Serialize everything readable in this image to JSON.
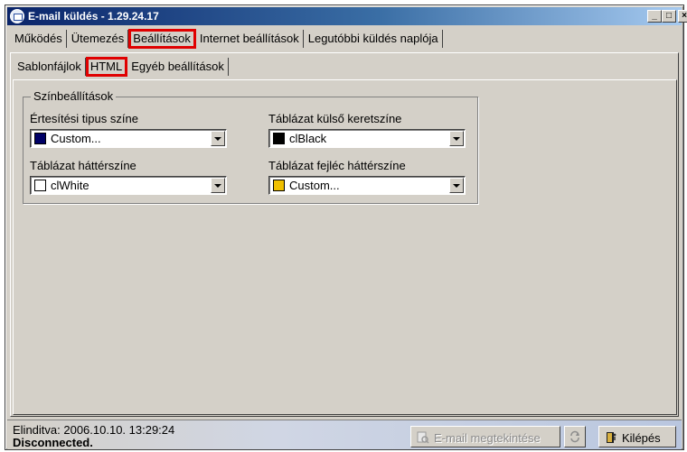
{
  "window": {
    "title": "E-mail küldés  - 1.29.24.17",
    "controls": {
      "minimize": "_",
      "maximize": "□",
      "close": "×"
    }
  },
  "main_tabs": [
    {
      "label": "Működés",
      "active": false
    },
    {
      "label": "Ütemezés",
      "active": false
    },
    {
      "label": "Beállítások",
      "active": true
    },
    {
      "label": "Internet beállítások",
      "active": false
    },
    {
      "label": "Legutóbbi küldés naplója",
      "active": false
    }
  ],
  "sub_tabs": [
    {
      "label": "Sablonfájlok",
      "active": false
    },
    {
      "label": "HTML",
      "active": true
    },
    {
      "label": "Egyéb beállítások",
      "active": false
    }
  ],
  "group": {
    "title": "Színbeállítások",
    "fields": [
      {
        "label": "Értesítési tipus színe",
        "value": "Custom...",
        "swatch": "#000066"
      },
      {
        "label": "Táblázat külső keretszíne",
        "value": "clBlack",
        "swatch": "#000000"
      },
      {
        "label": "Táblázat háttérszíne",
        "value": "clWhite",
        "swatch": "#ffffff"
      },
      {
        "label": "Táblázat fejléc háttérszíne",
        "value": "Custom...",
        "swatch": "#f0c000"
      }
    ]
  },
  "status": {
    "started": "Elinditva: 2006.10.10. 13:29:24",
    "connection": "Disconnected."
  },
  "buttons": {
    "preview": "E-mail megtekintése",
    "exit": "Kilépés"
  },
  "icons": {
    "preview": "document-preview-icon",
    "refresh": "refresh-icon",
    "exit": "exit-door-icon"
  },
  "colors": {
    "highlight": "#e00000",
    "titlebar_start": "#0a246a",
    "titlebar_end": "#a6caf0"
  }
}
